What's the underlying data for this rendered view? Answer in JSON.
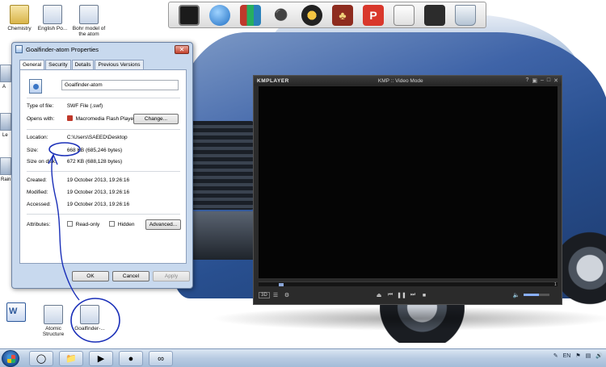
{
  "desktop": {
    "icons_top": [
      {
        "label": "Chemistry",
        "icon": "folder-icon"
      },
      {
        "label": "English Po...",
        "icon": "document-icon"
      },
      {
        "label": "Bohr model of the atom",
        "icon": "document-icon"
      }
    ],
    "icons_bottom": [
      {
        "label": "",
        "icon": "word-document-icon"
      },
      {
        "label": "Atomic Structure",
        "icon": "flash-file-icon"
      },
      {
        "label": "Goalfinder-...",
        "icon": "flash-file-icon"
      }
    ],
    "left_stub_labels": [
      "A",
      "Le",
      "Rain"
    ]
  },
  "dock": {
    "items": [
      "monitor-icon",
      "globe-icon",
      "books-icon",
      "headphones-icon",
      "film-reel-icon",
      "cards-icon",
      "powerpoint-icon",
      "notepad-icon",
      "briefcase-icon",
      "recycle-bin-icon"
    ]
  },
  "properties": {
    "title": "Goalfinder-atom Properties",
    "tabs": [
      "General",
      "Security",
      "Details",
      "Previous Versions"
    ],
    "active_tab": "General",
    "file_name": "Goalfinder-atom",
    "type_label": "Type of file:",
    "type_value": "SWF File (.swf)",
    "opens_label": "Opens with:",
    "opens_value": "Macromedia Flash Playe",
    "change_label": "Change...",
    "location_label": "Location:",
    "location_value": "C:\\Users\\SAEED\\Desktop",
    "size_label": "Size:",
    "size_value": "668 KB (685,246 bytes)",
    "size_on_disk_label": "Size on disk:",
    "size_on_disk_value": "672 KB (688,128 bytes)",
    "created_label": "Created:",
    "created_value": "19 October 2013, 19:26:16",
    "modified_label": "Modified:",
    "modified_value": "19 October 2013, 19:26:16",
    "accessed_label": "Accessed:",
    "accessed_value": "19 October 2013, 19:26:16",
    "attributes_label": "Attributes:",
    "readonly_label": "Read-only",
    "hidden_label": "Hidden",
    "advanced_label": "Advanced...",
    "ok_label": "OK",
    "cancel_label": "Cancel",
    "apply_label": "Apply"
  },
  "kmplayer": {
    "logo": "KMPLAYER",
    "title": "KMP :: Video Mode",
    "seek_start": "2",
    "seek_end": "1",
    "seek_progress": 0.07,
    "volume_level": 0.6,
    "mode_badge": "3D"
  },
  "taskbar": {
    "items": [
      "explorer-icon",
      "ie-icon",
      "folder-icon",
      "media-player-icon",
      "globe-icon",
      "visual-studio-icon"
    ],
    "tray_lang": "EN"
  },
  "annotations": {
    "color": "#1a2fb8"
  }
}
